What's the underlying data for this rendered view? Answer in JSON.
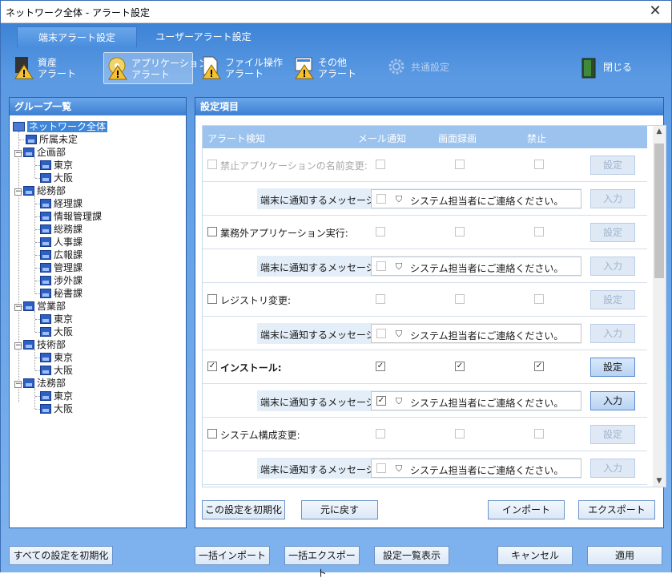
{
  "window": {
    "title": "ネットワーク全体 - アラート設定",
    "close": "✕"
  },
  "tabs": [
    {
      "label": "端末アラート設定"
    },
    {
      "label": "ユーザーアラート設定"
    }
  ],
  "toolbar": {
    "asset": [
      "資産",
      "アラート"
    ],
    "app": [
      "アプリケーション",
      "アラート"
    ],
    "file": [
      "ファイル操作",
      "アラート"
    ],
    "other": [
      "その他",
      "アラート"
    ],
    "common": "共通設定",
    "close": "閉じる"
  },
  "left_panel": {
    "title": "グループ一覧"
  },
  "tree": {
    "root": "ネットワーク全体",
    "items": [
      "所属未定",
      "企画部",
      "東京",
      "大阪",
      "総務部",
      "経理課",
      "情報管理課",
      "総務課",
      "人事課",
      "広報課",
      "管理課",
      "渉外課",
      "秘書課",
      "営業部",
      "東京",
      "大阪",
      "技術部",
      "東京",
      "大阪",
      "法務部",
      "東京",
      "大阪"
    ]
  },
  "right_panel": {
    "title": "設定項目"
  },
  "grid": {
    "headers": [
      "アラート検知",
      "メール通知",
      "画面録画",
      "禁止"
    ],
    "msg_label": "端末に通知するメッセージ:",
    "msg_value": "システム担当者にご連絡ください。",
    "set_label": "設定",
    "input_label": "入力",
    "rows": [
      {
        "label": "禁止アプリケーションの名前変更:",
        "checked": false,
        "disabled": true
      },
      {
        "label": "業務外アプリケーション実行:",
        "checked": false,
        "disabled": false
      },
      {
        "label": "レジストリ変更:",
        "checked": false,
        "disabled": false
      },
      {
        "label": "インストール:",
        "checked": true,
        "disabled": false
      },
      {
        "label": "システム構成変更:",
        "checked": false,
        "disabled": false
      }
    ]
  },
  "panel_buttons": {
    "reset": "この設定を初期化",
    "undo": "元に戻す",
    "import": "インポート",
    "export": "エクスポート"
  },
  "bottom_buttons": {
    "reset_all": "すべての設定を初期化",
    "bulk_import": "一括インポート",
    "bulk_export": "一括エクスポート",
    "list": "設定一覧表示",
    "cancel": "キャンセル",
    "apply": "適用"
  },
  "icons": {
    "close": "close-icon",
    "check": "✓",
    "person": "person-icon"
  },
  "colors": {
    "header_blue": "#3d83d6",
    "grid_header": "#9cc3ee",
    "selected_tree": "#3f86d8"
  }
}
